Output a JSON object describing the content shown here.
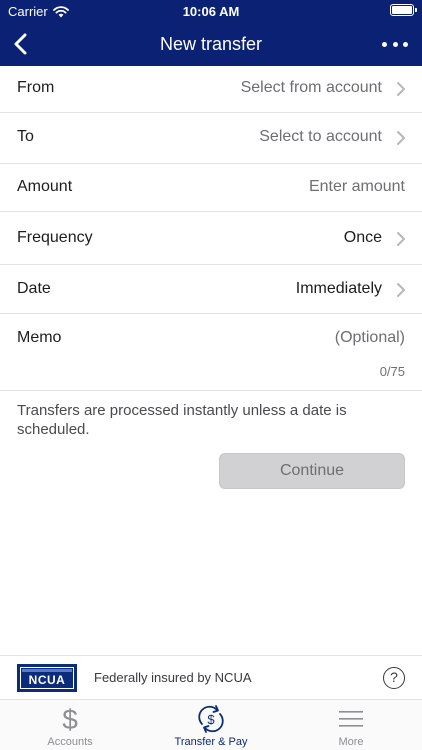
{
  "status_bar": {
    "carrier": "Carrier",
    "time": "10:06 AM"
  },
  "nav": {
    "title": "New transfer"
  },
  "form": {
    "from": {
      "label": "From",
      "value": "Select from account"
    },
    "to": {
      "label": "To",
      "value": "Select to account"
    },
    "amount": {
      "label": "Amount",
      "placeholder": "Enter amount"
    },
    "frequency": {
      "label": "Frequency",
      "value": "Once"
    },
    "date": {
      "label": "Date",
      "value": "Immediately"
    },
    "memo": {
      "label": "Memo",
      "placeholder": "(Optional)",
      "counter": "0/75"
    }
  },
  "note": "Transfers are processed instantly unless a date is scheduled.",
  "continue_label": "Continue",
  "ncua": {
    "logo_text": "NCUA",
    "text": "Federally insured by NCUA",
    "help_glyph": "?"
  },
  "tabs": [
    {
      "label": "Accounts",
      "icon": "dollar-icon"
    },
    {
      "label": "Transfer & Pay",
      "icon": "transfer-pay-icon"
    },
    {
      "label": "More",
      "icon": "menu-icon"
    }
  ],
  "colors": {
    "header": "#0b2274",
    "accent": "#0b2c7a",
    "disabled_button": "#d1d1d3"
  }
}
